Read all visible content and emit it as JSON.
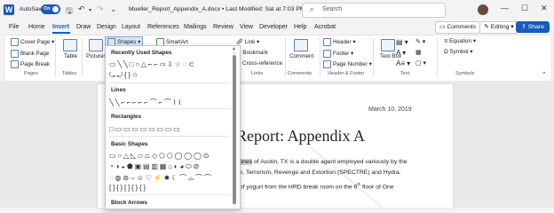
{
  "titlebar": {
    "autosave_label": "AutoSave",
    "autosave_state": "On",
    "doc_title": "Mueller_Report_Appendix_A.docx • Last Modified: Sat at 7:03 PM",
    "search_placeholder": "Search",
    "minimize": "—",
    "maximize": "☐",
    "close": "✕"
  },
  "tabs": [
    "File",
    "Home",
    "Insert",
    "Draw",
    "Design",
    "Layout",
    "References",
    "Mailings",
    "Review",
    "View",
    "Developer",
    "Help",
    "Acrobat"
  ],
  "actions": {
    "comments": "Comments",
    "editing": "Editing",
    "share": "Share"
  },
  "ribbon": {
    "pages": {
      "cover": "Cover Page",
      "blank": "Blank Page",
      "pagebreak": "Page Break",
      "group": "Pages"
    },
    "tables": {
      "table": "Table",
      "group": "Tables"
    },
    "illustrations": {
      "pictures": "Pictures",
      "shapes": "Shapes",
      "smartart": "SmartArt"
    },
    "links": {
      "link": "Link",
      "bookmark": "Bookmark",
      "crossref": "Cross-reference",
      "group": "Links"
    },
    "comments": {
      "comment": "Comment",
      "group": "Comments"
    },
    "hf": {
      "header": "Header",
      "footer": "Footer",
      "pagenumber": "Page Number",
      "group": "Header & Footer"
    },
    "text": {
      "textbox": "Text Box",
      "group": "Text"
    },
    "symbols": {
      "equation": "Equation",
      "symbol": "Symbol",
      "group": "Symbols"
    }
  },
  "shapes_menu": {
    "sections": [
      {
        "title": "Recently Used Shapes",
        "rows": [
          "▭╲╲□○△⌐⌐⇨⇩☆◌⊂",
          "⤿⤾{}☆"
        ]
      },
      {
        "title": "Lines",
        "rows": [
          "╲╲⌐⌐⌐⌐⌐⌒⌐⌒⌇⌇"
        ]
      },
      {
        "title": "Rectangles",
        "rows": [
          "□▭▭▭▭▭▭▭▭"
        ]
      },
      {
        "title": "Basic Shapes",
        "rows": [
          "▭○△◺▱⏢◇⬠⬡◯◯◯⊙",
          "◔◑◒⬟▣▤▥▦⌂◐◕⬭⊘",
          "◌◍⊚⌣☺♡⚡✹☾⌒⌓⌒⌒",
          "[]{}[]{}{}"
        ]
      },
      {
        "title": "Block Arrows",
        "rows": []
      }
    ]
  },
  "document": {
    "date": "March 10, 2019",
    "heading": "Report: Appendix A",
    "line1_hl": "Jones",
    "line1_rest": " of Austin, TX is a double agent employed variously by the",
    "line2": "ce, Terrorism, Revenge and Extortion (SPECTRE) and Hydra.",
    "line3_a": "t of yogurt from the HRD break room on the 6",
    "line3_sup": "th",
    "line3_b": " floor of One"
  }
}
